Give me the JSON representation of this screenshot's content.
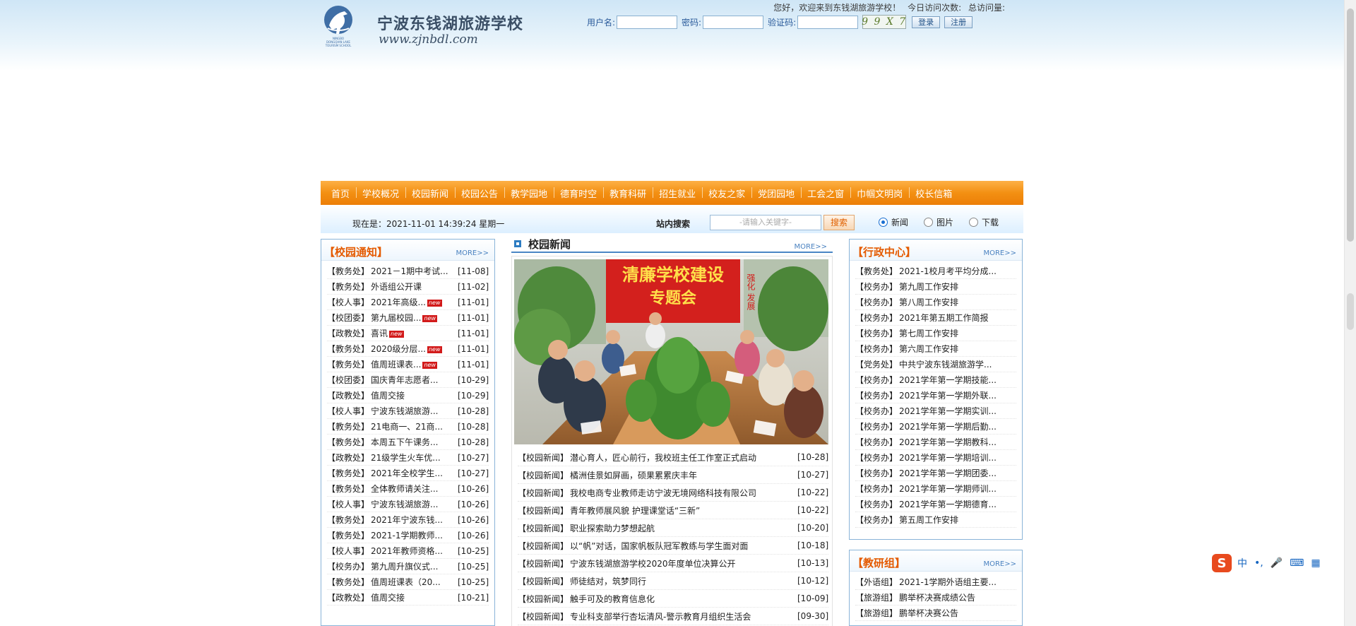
{
  "header": {
    "school_name": "宁波东钱湖旅游学校",
    "url": "www.zjnbdl.com",
    "logo_small_text": [
      "NINGBO",
      "DONGQIAN LAKE",
      "TOURISM SCHOOL"
    ]
  },
  "welcome": {
    "greeting": "您好，欢迎来到东钱湖旅游学校！",
    "today_visits": "今日访问次数:",
    "total_visits": "总访问量:"
  },
  "login": {
    "username_label": "用户名:",
    "password_label": "密码:",
    "captcha_label": "验证码:",
    "captcha_text": "9 9 X 7",
    "login_button": "登录",
    "register_button": "注册"
  },
  "nav": {
    "items": [
      "首页",
      "学校概况",
      "校园新闻",
      "校园公告",
      "教学园地",
      "德育时空",
      "教育科研",
      "招生就业",
      "校友之家",
      "党团园地",
      "工会之窗",
      "巾帼文明岗",
      "校长信箱"
    ]
  },
  "subbar": {
    "now_label": "现在是：2021-11-01 14:39:24 星期一",
    "search_label": "站内搜索",
    "search_placeholder": "-请输入关键字-",
    "search_button": "搜索",
    "radio_options": [
      "新闻",
      "图片",
      "下载"
    ],
    "selected_radio": "新闻"
  },
  "notice": {
    "title": "【校园通知】",
    "more": "MORE>>",
    "items": [
      {
        "cat": "【教务处】",
        "title": "2021－1期中考试...",
        "date": "[11-08]",
        "is_new": false
      },
      {
        "cat": "【教务处】",
        "title": "外语组公开课",
        "date": "[11-02]",
        "is_new": false
      },
      {
        "cat": "【校人事】",
        "title": "2021年高级...",
        "date": "[11-01]",
        "is_new": true
      },
      {
        "cat": "【校团委】",
        "title": "第九届校园...",
        "date": "[11-01]",
        "is_new": true
      },
      {
        "cat": "【政教处】",
        "title": "喜讯",
        "date": "[11-01]",
        "is_new": true
      },
      {
        "cat": "【教务处】",
        "title": "2020级分层...",
        "date": "[11-01]",
        "is_new": true
      },
      {
        "cat": "【教务处】",
        "title": "值周班课表...",
        "date": "[11-01]",
        "is_new": true
      },
      {
        "cat": "【校团委】",
        "title": "国庆青年志愿者...",
        "date": "[10-29]",
        "is_new": false
      },
      {
        "cat": "【政教处】",
        "title": "值周交接",
        "date": "[10-29]",
        "is_new": false
      },
      {
        "cat": "【校人事】",
        "title": "宁波东钱湖旅游...",
        "date": "[10-28]",
        "is_new": false
      },
      {
        "cat": "【教务处】",
        "title": "21电商一、21商...",
        "date": "[10-28]",
        "is_new": false
      },
      {
        "cat": "【教务处】",
        "title": "本周五下午课务...",
        "date": "[10-28]",
        "is_new": false
      },
      {
        "cat": "【政教处】",
        "title": "21级学生火车优...",
        "date": "[10-27]",
        "is_new": false
      },
      {
        "cat": "【教务处】",
        "title": "2021年全校学生...",
        "date": "[10-27]",
        "is_new": false
      },
      {
        "cat": "【教务处】",
        "title": "全体教师请关注...",
        "date": "[10-26]",
        "is_new": false
      },
      {
        "cat": "【校人事】",
        "title": "宁波东钱湖旅游...",
        "date": "[10-26]",
        "is_new": false
      },
      {
        "cat": "【教务处】",
        "title": "2021年宁波东钱...",
        "date": "[10-26]",
        "is_new": false
      },
      {
        "cat": "【教务处】",
        "title": "2021-1学期教师...",
        "date": "[10-26]",
        "is_new": false
      },
      {
        "cat": "【校人事】",
        "title": "2021年教师资格...",
        "date": "[10-25]",
        "is_new": false
      },
      {
        "cat": "【校务办】",
        "title": "第九周升旗仪式...",
        "date": "[10-25]",
        "is_new": false
      },
      {
        "cat": "【教务处】",
        "title": "值周班课表（20...",
        "date": "[10-25]",
        "is_new": false
      },
      {
        "cat": "【政教处】",
        "title": "值周交接",
        "date": "[10-21]",
        "is_new": false
      }
    ]
  },
  "news": {
    "title": "校园新闻",
    "more": "MORE>>",
    "photo_banner_line1": "清廉学校建设",
    "photo_banner_line2": "专题会",
    "photo_side_text": "强化 发展",
    "items": [
      {
        "cat": "【校园新闻】",
        "title": "潜心育人，匠心前行，我校班主任工作室正式启动",
        "date": "[10-28]"
      },
      {
        "cat": "【校园新闻】",
        "title": "橘洲佳景如屏画，硕果累累庆丰年",
        "date": "[10-27]"
      },
      {
        "cat": "【校园新闻】",
        "title": "我校电商专业教师走访宁波无境网络科技有限公司",
        "date": "[10-22]"
      },
      {
        "cat": "【校园新闻】",
        "title": "青年教师展风貌 护理课堂话“三新”",
        "date": "[10-22]"
      },
      {
        "cat": "【校园新闻】",
        "title": "职业探索助力梦想起航",
        "date": "[10-20]"
      },
      {
        "cat": "【校园新闻】",
        "title": "以“帆”对话，国家帆板队冠军教练与学生面对面",
        "date": "[10-18]"
      },
      {
        "cat": "【校园新闻】",
        "title": "宁波东钱湖旅游学校2020年度单位决算公开",
        "date": "[10-13]"
      },
      {
        "cat": "【校园新闻】",
        "title": "师徒结对，筑梦同行",
        "date": "[10-12]"
      },
      {
        "cat": "【校园新闻】",
        "title": "触手可及的教育信息化",
        "date": "[10-09]"
      },
      {
        "cat": "【校园新闻】",
        "title": "专业科支部举行杏坛清风-警示教育月组织生活会",
        "date": "[09-30]"
      }
    ]
  },
  "admin": {
    "title": "【行政中心】",
    "more": "MORE>>",
    "items": [
      {
        "cat": "【教务处】",
        "title": "2021-1校月考平均分成..."
      },
      {
        "cat": "【校务办】",
        "title": "第九周工作安排"
      },
      {
        "cat": "【校务办】",
        "title": "第八周工作安排"
      },
      {
        "cat": "【校务办】",
        "title": "2021年第五期工作简报"
      },
      {
        "cat": "【校务办】",
        "title": "第七周工作安排"
      },
      {
        "cat": "【校务办】",
        "title": "第六周工作安排"
      },
      {
        "cat": "【党务处】",
        "title": "中共宁波东钱湖旅游学..."
      },
      {
        "cat": "【校务办】",
        "title": "2021学年第一学期技能..."
      },
      {
        "cat": "【校务办】",
        "title": "2021学年第一学期外联..."
      },
      {
        "cat": "【校务办】",
        "title": "2021学年第一学期实训..."
      },
      {
        "cat": "【校务办】",
        "title": "2021学年第一学期后勤..."
      },
      {
        "cat": "【校务办】",
        "title": "2021学年第一学期教科..."
      },
      {
        "cat": "【校务办】",
        "title": "2021学年第一学期培训..."
      },
      {
        "cat": "【校务办】",
        "title": "2021学年第一学期团委..."
      },
      {
        "cat": "【校务办】",
        "title": "2021学年第一学期师训..."
      },
      {
        "cat": "【校务办】",
        "title": "2021学年第一学期德育..."
      },
      {
        "cat": "【校务办】",
        "title": "第五周工作安排"
      }
    ]
  },
  "research": {
    "title": "【教研组】",
    "more": "MORE>>",
    "items": [
      {
        "cat": "【外语组】",
        "title": "2021-1学期外语组主要..."
      },
      {
        "cat": "【旅游组】",
        "title": "鹏举杯决赛成绩公告"
      },
      {
        "cat": "【旅游组】",
        "title": "鹏举杯决赛公告"
      }
    ]
  },
  "ime": {
    "logo": "S",
    "items": [
      "中",
      "•,",
      "🎤",
      "⌨",
      "▦"
    ]
  }
}
